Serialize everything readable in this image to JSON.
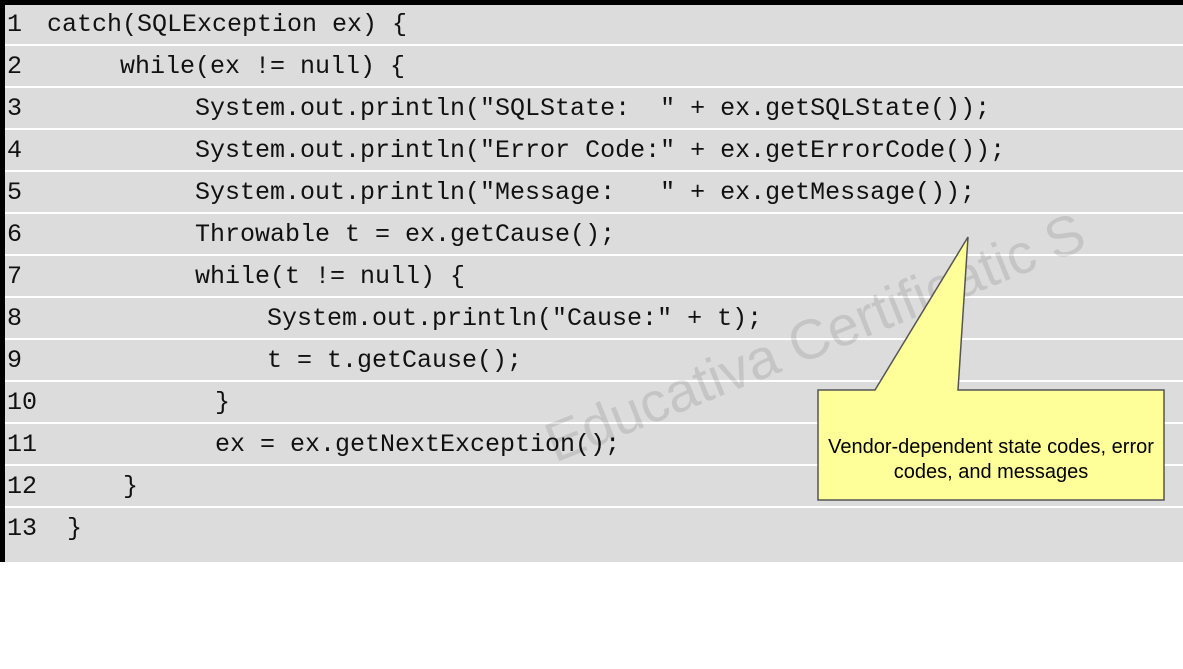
{
  "code": {
    "lines": [
      {
        "num": "1",
        "text": "catch(SQLException ex) {"
      },
      {
        "num": "2",
        "text": "while(ex != null) {"
      },
      {
        "num": "3",
        "text": "System.out.println(\"SQLState:  \" + ex.getSQLState());"
      },
      {
        "num": "4",
        "text": "System.out.println(\"Error Code:\" + ex.getErrorCode());"
      },
      {
        "num": "5",
        "text": "System.out.println(\"Message:   \" + ex.getMessage());"
      },
      {
        "num": "6",
        "text": "Throwable t = ex.getCause();"
      },
      {
        "num": "7",
        "text": "while(t != null) {"
      },
      {
        "num": "8",
        "text": "System.out.println(\"Cause:\" + t);"
      },
      {
        "num": "9",
        "text": "t = t.getCause();"
      },
      {
        "num": "10",
        "text": "}"
      },
      {
        "num": "11",
        "text": "ex = ex.getNextException();"
      },
      {
        "num": "12",
        "text": "}"
      },
      {
        "num": "13",
        "text": "}"
      }
    ]
  },
  "callout": {
    "text": "Vendor-dependent state codes, error codes, and messages",
    "fill_color": "#ffff99"
  },
  "watermark": "Educativa Certificatic S",
  "colors": {
    "code_background": "#dcdcdc",
    "border": "#000000"
  }
}
